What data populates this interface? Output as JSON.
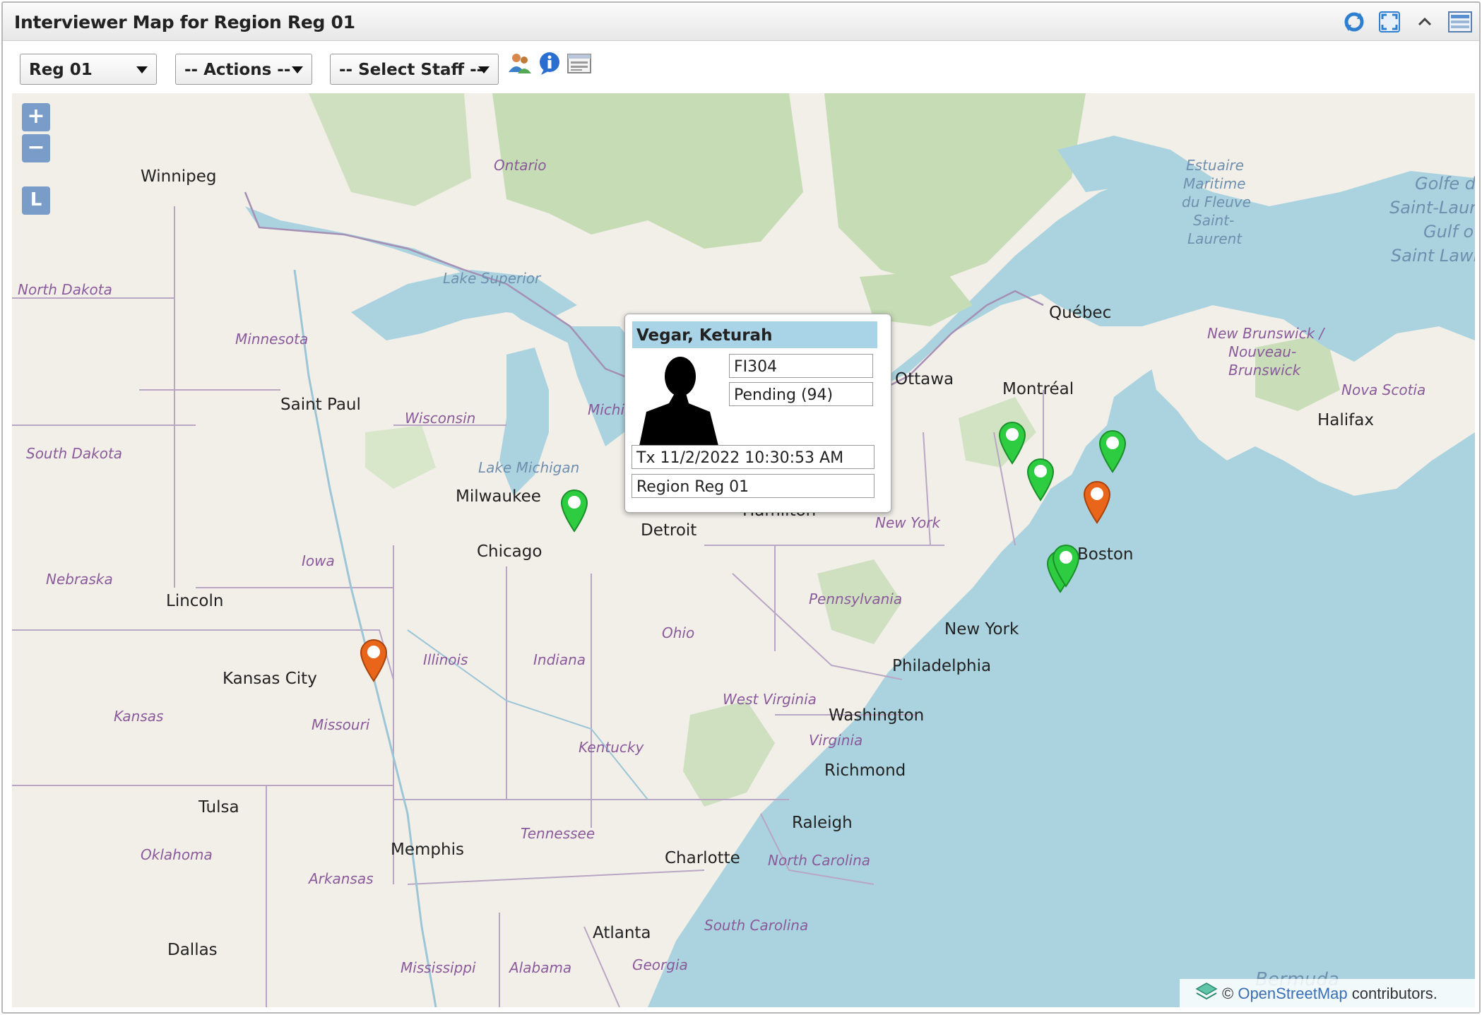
{
  "window": {
    "title": "Interviewer Map for Region Reg 01",
    "tools": [
      "refresh-icon",
      "fullscreen-icon",
      "collapse-icon",
      "menu-icon"
    ]
  },
  "toolbar": {
    "region_select": "Reg 01",
    "actions_select": "-- Actions --",
    "staff_select": "-- Select Staff --",
    "icons": [
      "users-icon",
      "info-icon",
      "list-icon"
    ]
  },
  "map": {
    "zoom_in": "+",
    "zoom_out": "−",
    "layers": "L",
    "labels": {
      "winnipeg": "Winnipeg",
      "ontario": "Ontario",
      "north_dakota": "North Dakota",
      "lake_superior": "Lake Superior",
      "minnesota": "Minnesota",
      "saint_paul": "Saint Paul",
      "wisconsin": "Wisconsin",
      "south_dakota": "South Dakota",
      "michigan": "Michi",
      "lake_michigan": "Lake Michigan",
      "milwaukee": "Milwaukee",
      "detroit": "Detroit",
      "hamilton": "Hamilton",
      "chicago": "Chicago",
      "iowa": "Iowa",
      "nebraska": "Nebraska",
      "lincoln": "Lincoln",
      "illinois": "Illinois",
      "indiana": "Indiana",
      "ohio": "Ohio",
      "kansas_city": "Kansas City",
      "kansas": "Kansas",
      "missouri": "Missouri",
      "pennsylvania": "Pennsylvania",
      "new_york_state": "New York",
      "new_york": "New York",
      "philadelphia": "Philadelphia",
      "west_virginia": "West Virginia",
      "washington": "Washington",
      "virginia": "Virginia",
      "kentucky": "Kentucky",
      "richmond": "Richmond",
      "tulsa": "Tulsa",
      "oklahoma": "Oklahoma",
      "tennessee": "Tennessee",
      "memphis": "Memphis",
      "raleigh": "Raleigh",
      "charlotte": "Charlotte",
      "north_carolina": "North Carolina",
      "arkansas": "Arkansas",
      "atlanta": "Atlanta",
      "south_carolina": "South Carolina",
      "dallas": "Dallas",
      "mississippi": "Mississippi",
      "alabama": "Alabama",
      "georgia": "Georgia",
      "ottawa": "Ottawa",
      "montreal": "Montréal",
      "quebec": "Québec",
      "boston": "Boston",
      "halifax": "Halifax",
      "nova_scotia": "Nova Scotia",
      "new_brunswick_1": "New Brunswick /",
      "new_brunswick_2": "Nouveau-",
      "new_brunswick_3": "Brunswick",
      "estuaire_1": "Estuaire",
      "estuaire_2": "Maritime",
      "estuaire_3": "du Fleuve",
      "estuaire_4": "Saint-",
      "estuaire_5": "Laurent",
      "golfe_1": "Golfe d",
      "golfe_2": "Saint-Laur",
      "golfe_3": "Gulf o",
      "golfe_4": "Saint Lawr",
      "bermuda": "Bermuda"
    },
    "attribution_prefix": "© ",
    "attribution_link": "OpenStreetMap",
    "attribution_suffix": " contributors.",
    "marker_colors": {
      "green": "#2ecc40",
      "orange": "#e8651a"
    }
  },
  "popup": {
    "name": "Vegar, Keturah",
    "code": "FI304",
    "status": "Pending (94)",
    "tx": "Tx 11/2/2022 10:30:53 AM",
    "region": "Region Reg 01"
  }
}
